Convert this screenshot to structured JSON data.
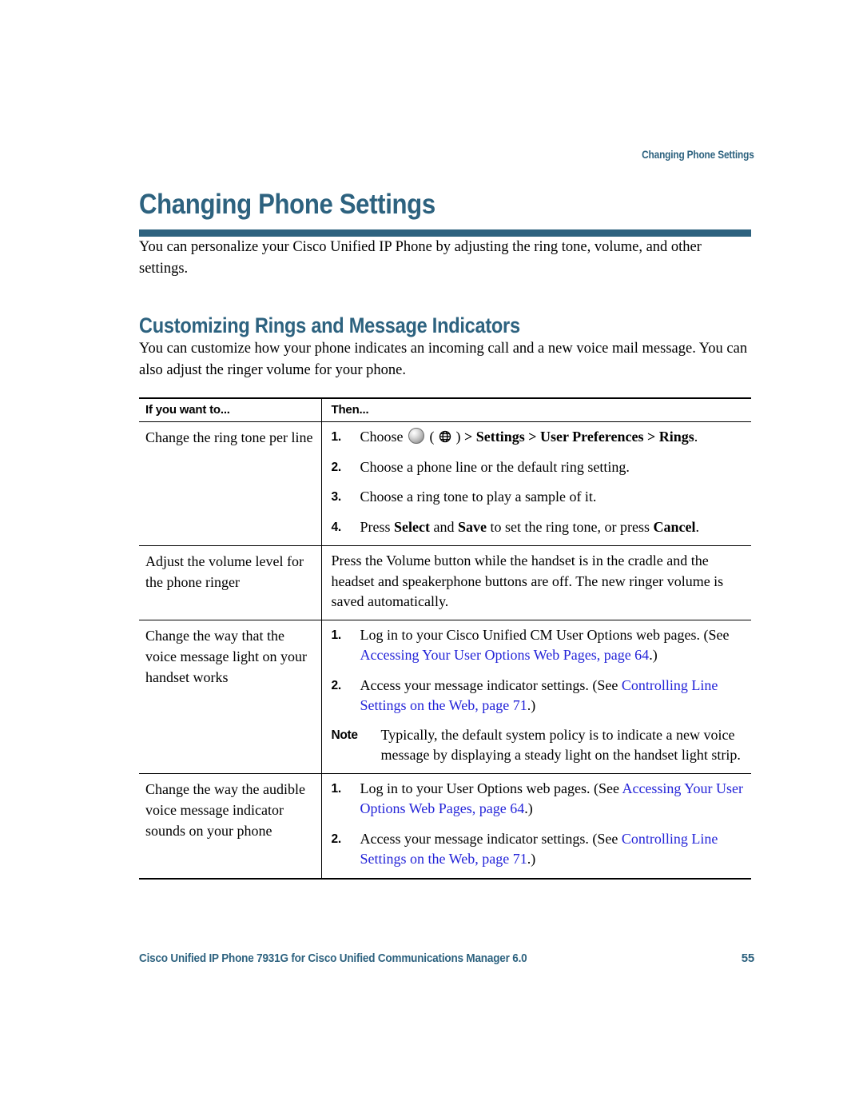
{
  "running_head": "Changing Phone Settings",
  "chapter_title": "Changing Phone Settings",
  "intro_paragraph": "You can personalize your Cisco Unified IP Phone by adjusting the ring tone, volume, and other settings.",
  "section": {
    "title": "Customizing Rings and Message Indicators",
    "paragraph": "You can customize how your phone indicates an incoming call and a new voice mail message. You can also adjust the ringer volume for your phone."
  },
  "table": {
    "headers": {
      "col1": "If you want to...",
      "col2": "Then..."
    },
    "rows": [
      {
        "want": "Change the ring tone per line",
        "type": "steps",
        "steps": [
          {
            "num": "1.",
            "parts": [
              {
                "t": "text",
                "v": "Choose "
              },
              {
                "t": "icon",
                "v": "settings-ball-icon"
              },
              {
                "t": "text",
                "v": " ( "
              },
              {
                "t": "icon",
                "v": "globe-settings-icon"
              },
              {
                "t": "text",
                "v": " ) "
              },
              {
                "t": "bold",
                "v": "> Settings > User Preferences > Rings"
              },
              {
                "t": "text",
                "v": "."
              }
            ]
          },
          {
            "num": "2.",
            "parts": [
              {
                "t": "text",
                "v": "Choose a phone line or the default ring setting."
              }
            ]
          },
          {
            "num": "3.",
            "parts": [
              {
                "t": "text",
                "v": "Choose a ring tone to play a sample of it."
              }
            ]
          },
          {
            "num": "4.",
            "parts": [
              {
                "t": "text",
                "v": "Press "
              },
              {
                "t": "bold",
                "v": "Select"
              },
              {
                "t": "text",
                "v": " and "
              },
              {
                "t": "bold",
                "v": "Save"
              },
              {
                "t": "text",
                "v": " to set the ring tone, or press "
              },
              {
                "t": "bold",
                "v": "Cancel"
              },
              {
                "t": "text",
                "v": "."
              }
            ]
          }
        ]
      },
      {
        "want": "Adjust the volume level for the phone ringer",
        "type": "paragraph",
        "paragraph": "Press the Volume button while the handset is in the cradle and the headset and speakerphone buttons are off. The new ringer volume is saved automatically."
      },
      {
        "want": "Change the way that the voice message light on your handset works",
        "type": "steps",
        "steps": [
          {
            "num": "1.",
            "parts": [
              {
                "t": "text",
                "v": "Log in to your Cisco Unified CM User Options web pages. (See "
              },
              {
                "t": "xref",
                "v": "Accessing Your User Options Web Pages, page 64"
              },
              {
                "t": "text",
                "v": ".)"
              }
            ]
          },
          {
            "num": "2.",
            "parts": [
              {
                "t": "text",
                "v": "Access your message indicator settings. (See "
              },
              {
                "t": "xref",
                "v": "Controlling Line Settings on the Web, page 71"
              },
              {
                "t": "text",
                "v": ".)"
              }
            ]
          }
        ],
        "note": {
          "label": "Note",
          "text": "Typically, the default system policy is to indicate a new voice message by displaying a steady light on the handset light strip."
        }
      },
      {
        "want": "Change the way the audible voice message indicator sounds on your phone",
        "type": "steps",
        "steps": [
          {
            "num": "1.",
            "parts": [
              {
                "t": "text",
                "v": "Log in to your User Options web pages. (See "
              },
              {
                "t": "xref",
                "v": "Accessing Your User Options Web Pages, page 64"
              },
              {
                "t": "text",
                "v": ".)"
              }
            ]
          },
          {
            "num": "2.",
            "parts": [
              {
                "t": "text",
                "v": "Access your message indicator settings. (See "
              },
              {
                "t": "xref",
                "v": "Controlling Line Settings on the Web, page 71"
              },
              {
                "t": "text",
                "v": ".)"
              }
            ]
          }
        ]
      }
    ]
  },
  "footer": {
    "document": "Cisco Unified IP Phone 7931G for Cisco Unified Communications Manager 6.0",
    "page_number": "55"
  },
  "colors": {
    "heading": "#2d627f",
    "rule": "#2d627f",
    "xref_link": "#2323d8",
    "body_text": "#000000",
    "page_background": "#ffffff"
  }
}
